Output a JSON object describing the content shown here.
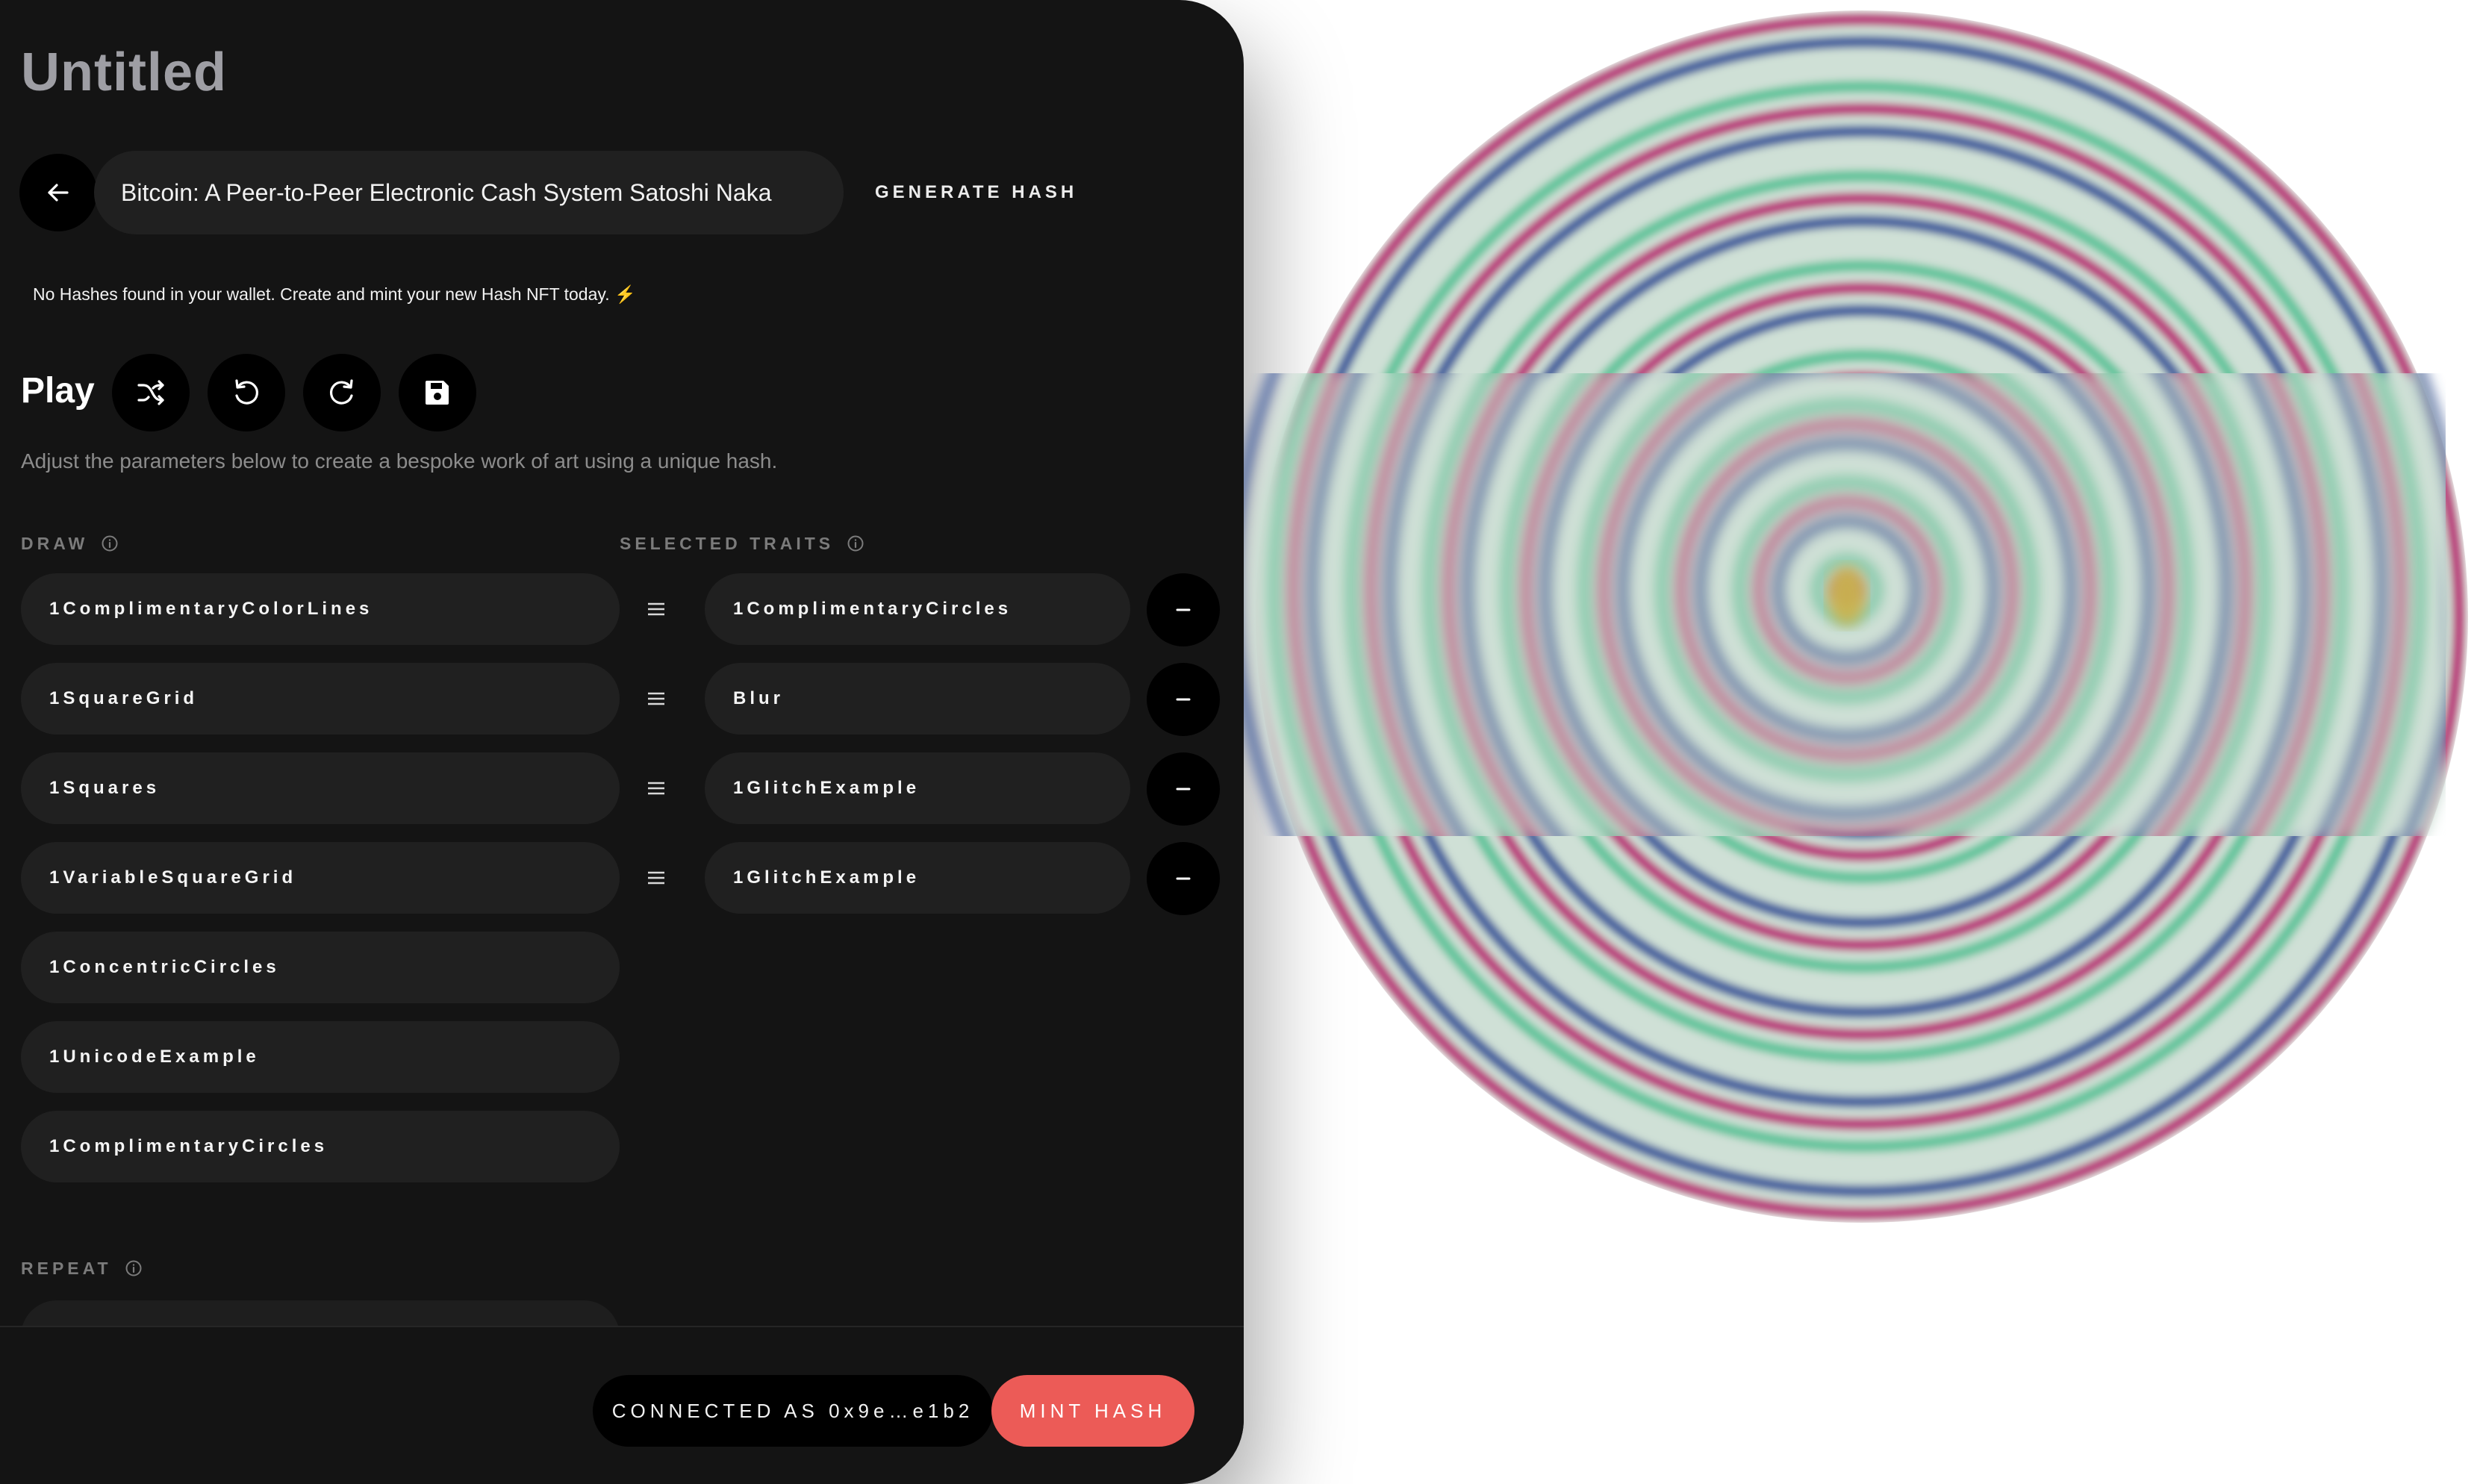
{
  "document": {
    "title": "Untitled"
  },
  "hash_bar": {
    "input_value": "Bitcoin: A Peer-to-Peer Electronic Cash System Satoshi Naka",
    "generate_label": "GENERATE HASH"
  },
  "notice": {
    "text": "No Hashes found in your wallet. Create and mint your new Hash NFT today.",
    "emoji": "⚡"
  },
  "play": {
    "label": "Play",
    "tools": [
      "shuffle-icon",
      "undo-icon",
      "redo-icon",
      "save-icon"
    ],
    "description": "Adjust the parameters below to create a bespoke work of art using a unique hash."
  },
  "draw": {
    "label": "DRAW",
    "items": [
      "1ComplimentaryColorLines",
      "1SquareGrid",
      "1Squares",
      "1VariableSquareGrid",
      "1ConcentricCircles",
      "1UnicodeExample",
      "1ComplimentaryCircles"
    ]
  },
  "selected_traits": {
    "label": "SELECTED TRAITS",
    "items": [
      "1ComplimentaryCircles",
      "Blur",
      "1GlitchExample",
      "1GlitchExample"
    ]
  },
  "repeat": {
    "label": "REPEAT"
  },
  "footer": {
    "connected_label": "CONNECTED AS 0x9e…e1b2",
    "mint_label": "MINT HASH"
  },
  "colors": {
    "panel_bg": "#141414",
    "pill_bg": "#202020",
    "accent_mint": "#ec5b57",
    "ring_magenta": "#b9357a",
    "ring_blue": "#45609e",
    "ring_light": "#cfe0d6",
    "ring_green": "#63c49c"
  }
}
